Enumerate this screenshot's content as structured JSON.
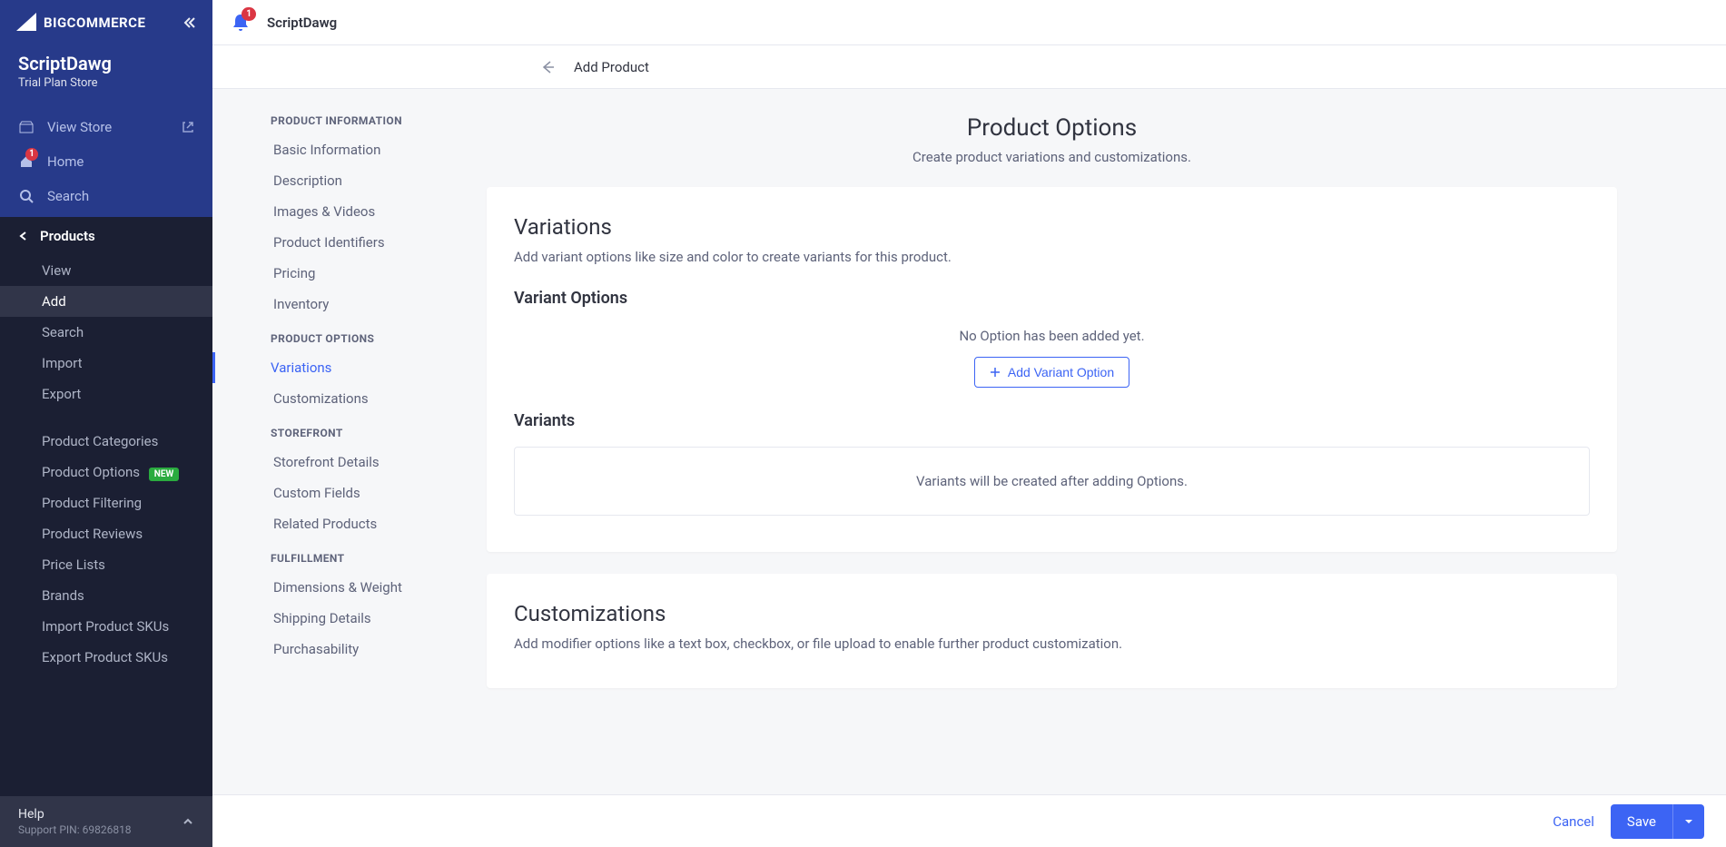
{
  "brand": "BIGCOMMERCE",
  "store": {
    "name": "ScriptDawg",
    "plan": "Trial Plan Store"
  },
  "notifications": {
    "bell_badge": "1",
    "home_badge": "1"
  },
  "topnav": {
    "view_store": "View Store",
    "home": "Home",
    "search": "Search"
  },
  "section": {
    "title": "Products"
  },
  "subnav": {
    "view": "View",
    "add": "Add",
    "search": "Search",
    "import": "Import",
    "export": "Export",
    "product_categories": "Product Categories",
    "product_options": "Product Options",
    "product_filtering": "Product Filtering",
    "product_reviews": "Product Reviews",
    "price_lists": "Price Lists",
    "brands": "Brands",
    "import_skus": "Import Product SKUs",
    "export_skus": "Export Product SKUs",
    "new_pill": "NEW"
  },
  "help": {
    "title": "Help",
    "pin": "Support PIN: 69826818"
  },
  "topbar": {
    "title": "ScriptDawg"
  },
  "subheader": {
    "title": "Add Product"
  },
  "secnav": {
    "g1": "PRODUCT INFORMATION",
    "g1_items": {
      "basic": "Basic Information",
      "desc": "Description",
      "images": "Images & Videos",
      "ids": "Product Identifiers",
      "pricing": "Pricing",
      "inventory": "Inventory"
    },
    "g2": "PRODUCT OPTIONS",
    "g2_items": {
      "variations": "Variations",
      "customizations": "Customizations"
    },
    "g3": "STOREFRONT",
    "g3_items": {
      "details": "Storefront Details",
      "custom": "Custom Fields",
      "related": "Related Products"
    },
    "g4": "FULFILLMENT",
    "g4_items": {
      "dims": "Dimensions & Weight",
      "shipping": "Shipping Details",
      "purch": "Purchasability"
    }
  },
  "page": {
    "title": "Product Options",
    "subtitle": "Create product variations and customizations."
  },
  "variations": {
    "heading": "Variations",
    "desc": "Add variant options like size and color to create variants for this product.",
    "options_heading": "Variant Options",
    "empty": "No Option has been added yet.",
    "add_btn": "Add Variant Option",
    "variants_heading": "Variants",
    "variants_empty": "Variants will be created after adding Options."
  },
  "customizations": {
    "heading": "Customizations",
    "desc": "Add modifier options like a text box, checkbox, or file upload to enable further product customization."
  },
  "footer": {
    "cancel": "Cancel",
    "save": "Save"
  }
}
